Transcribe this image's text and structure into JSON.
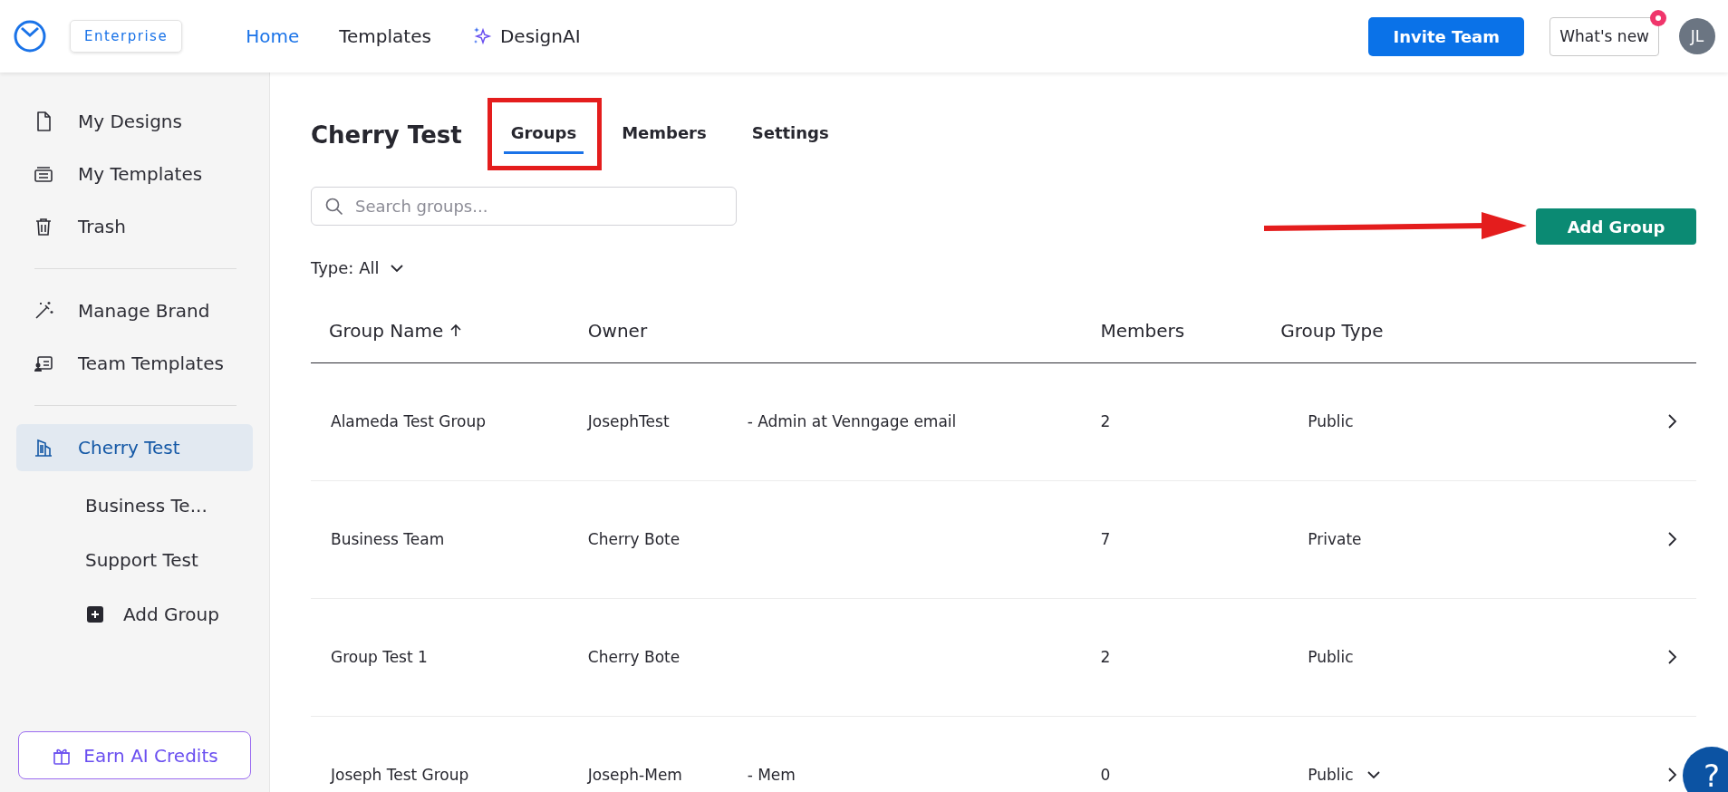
{
  "topbar": {
    "plan_badge": "Enterprise",
    "nav": [
      {
        "label": "Home",
        "selected": true,
        "kind": "plain"
      },
      {
        "label": "Templates",
        "selected": false,
        "kind": "plain"
      },
      {
        "label": "DesignAI",
        "selected": false,
        "kind": "ai"
      }
    ],
    "invite_button": "Invite Team",
    "whats_new": {
      "label": "What's new",
      "unread": true
    },
    "avatar": "JL"
  },
  "sidebar": {
    "sections": [
      {
        "items": [
          {
            "label": "My Designs",
            "selected": false
          },
          {
            "label": "My Templates",
            "selected": false
          },
          {
            "label": "Trash",
            "selected": false
          }
        ]
      },
      {
        "items": [
          {
            "label": "Manage Brand",
            "selected": false
          },
          {
            "label": "Team Templates",
            "selected": false
          }
        ]
      },
      {
        "items": [
          {
            "label": "Cherry Test",
            "selected": true,
            "children": [
              {
                "label": "Business Te...",
                "kind": "group"
              },
              {
                "label": "Support Test",
                "kind": "group"
              },
              {
                "label": "Add Group",
                "kind": "add"
              }
            ]
          }
        ]
      }
    ],
    "credits_button": "Earn AI Credits"
  },
  "page": {
    "title": "Cherry Test",
    "tabs": [
      {
        "label": "Groups",
        "selected": true,
        "highlighted": true
      },
      {
        "label": "Members",
        "selected": false,
        "highlighted": false
      },
      {
        "label": "Settings",
        "selected": false,
        "highlighted": false
      }
    ],
    "search": {
      "placeholder": "Search groups..."
    },
    "filter": "Type: All",
    "add_button": {
      "label": "Add Group",
      "pointed_by_arrow": true
    }
  },
  "table": {
    "columns": [
      {
        "label": "Group Name",
        "sorted": true
      },
      {
        "label": "Owner",
        "sorted": false
      },
      {
        "label": "Members",
        "sorted": false
      },
      {
        "label": "Group Type",
        "sorted": false
      }
    ],
    "rows": [
      {
        "name": "Alameda Test Group",
        "owner": "JosephTest",
        "owner_detail": "- Admin at Venngage email",
        "members": "2",
        "type": "Public",
        "type_expandable": false
      },
      {
        "name": "Business Team",
        "owner": "Cherry Bote",
        "members": "7",
        "type": "Private",
        "type_expandable": false
      },
      {
        "name": "Group Test 1",
        "owner": "Cherry Bote",
        "members": "2",
        "type": "Public",
        "type_expandable": false
      },
      {
        "name": "Joseph Test Group",
        "owner": "Joseph-Mem",
        "owner_detail": "- Mem",
        "members": "0",
        "type": "Public",
        "type_expandable": true
      }
    ]
  },
  "help_button": "?"
}
